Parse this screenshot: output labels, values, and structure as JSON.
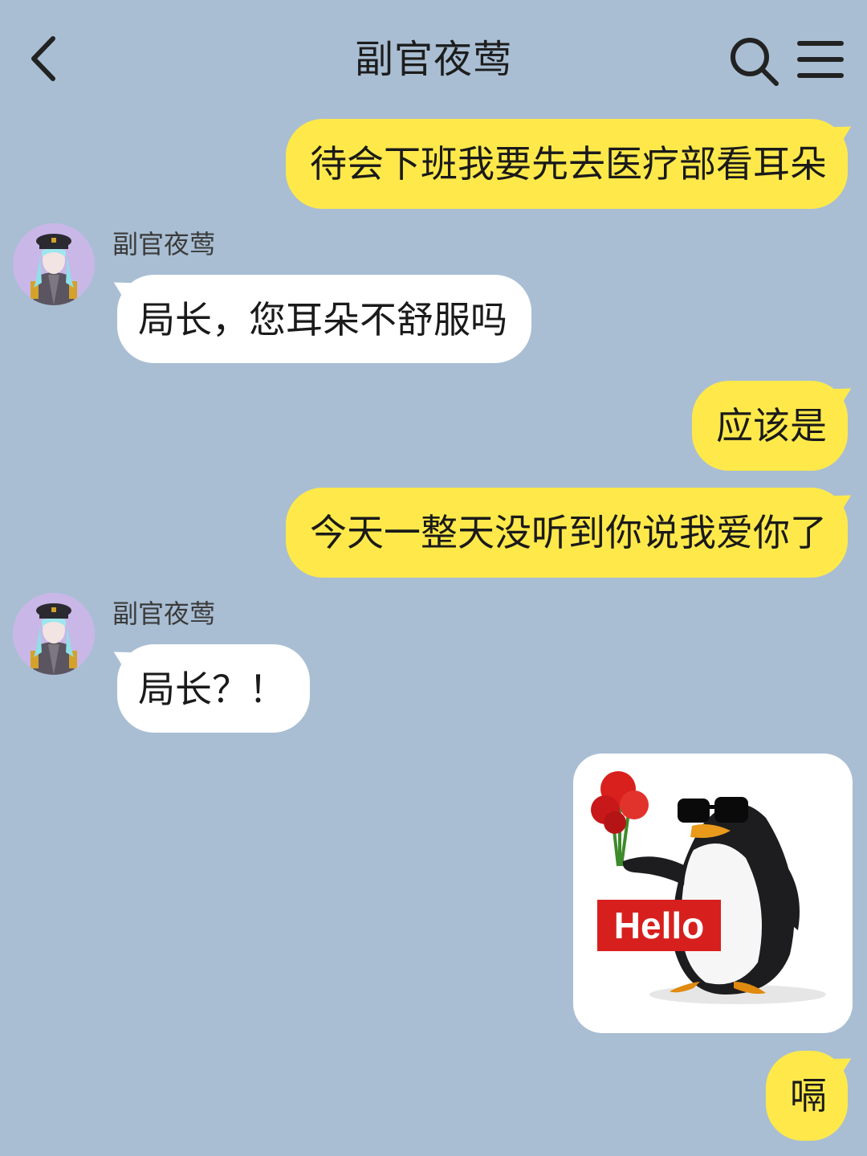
{
  "header": {
    "title": "副官夜莺",
    "back_icon": "chevron-left-icon",
    "search_icon": "search-icon",
    "menu_icon": "menu-icon"
  },
  "colors": {
    "background": "#a9bed3",
    "outgoing_bubble": "#ffe94a",
    "incoming_bubble": "#ffffff",
    "avatar_bg": "#c9b7e8"
  },
  "messages": [
    {
      "direction": "out",
      "text": "待会下班我要先去医疗部看耳朵"
    },
    {
      "direction": "in",
      "sender": "副官夜莺",
      "text": "局长，您耳朵不舒服吗"
    },
    {
      "direction": "out",
      "text": "应该是"
    },
    {
      "direction": "out",
      "text": "今天一整天没听到你说我爱你了"
    },
    {
      "direction": "in",
      "sender": "副官夜莺",
      "text": "局长？！"
    },
    {
      "direction": "out",
      "type": "sticker",
      "sticker_text": "Hello"
    },
    {
      "direction": "out",
      "text": "嗝"
    }
  ]
}
